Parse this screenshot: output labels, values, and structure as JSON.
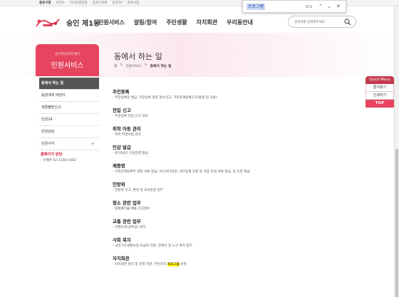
{
  "top_links": [
    "종로구청",
    "보건소",
    "역사문화관광",
    "종로구의회",
    "종로TV",
    "종로사랑"
  ],
  "find_bar": {
    "query": "프로그램",
    "count": "0/1"
  },
  "header": {
    "site_name": "숭인 제1동",
    "nav": [
      "민원서비스",
      "알림/참여",
      "주민생활",
      "자치회관",
      "우리동안내"
    ],
    "search_placeholder": "검색어를 입력해주세요"
  },
  "hero": {
    "title": "동에서 하는 일",
    "breadcrumb": [
      "홈",
      ">",
      "민원서비스",
      ">",
      "동에서 하는 일"
    ]
  },
  "sidebar": {
    "sub_title": "숭인제1동주민센터",
    "title": "민원서비스",
    "items": [
      "동에서 하는 일",
      "동장에게 바란다",
      "생활불편신고",
      "민원24",
      "민원상담",
      "민원서식"
    ],
    "contact_title": "홈페이지 담당",
    "contact_value": "- 유혜은 02-2148-5482"
  },
  "sections": [
    {
      "title": "주민등록",
      "desc": "- 주민등록증 발급, 주민등록 정정 접수신고, 가족관계등록신고(출생 및 사망)"
    },
    {
      "title": "전입 신고",
      "desc": "- 주민등록 전입 신고 처리"
    },
    {
      "title": "취학 아동 관리",
      "desc": "- 취학 학령아동 관리"
    },
    {
      "title": "인감 발급",
      "desc": "- 내·외국인 인감증명 발급"
    },
    {
      "title": "제증명",
      "desc": "- 가족관계등록부 관련 서류 발급, 어디서나민원, 세무증명 민원 등 각종 민원 서류 발급, 등.초본 발급"
    },
    {
      "title": "민방위",
      "desc": "- 민방위 신고, 편성 및 교육훈련 업무"
    },
    {
      "title": "청소 관련 업무",
      "desc": "- 대형폐기물 배출 신고접수"
    },
    {
      "title": "교통 관련 업무",
      "desc": "- 이면도로(골목길) 관리."
    },
    {
      "title": "사회 복지",
      "desc": "- 국민기초생활보장 수급자 지원, 장애인 및 노인 복지 업무"
    },
    {
      "title": "자치회관",
      "desc": "- 자치회관 관리 및 운영 지원, 주민자치 ",
      "highlight": "프로그램",
      "desc_after": " 운영"
    }
  ],
  "quick_menu": {
    "title": "Quick Menu",
    "items": [
      "즐겨찾기",
      "인쇄하기"
    ],
    "top": "TOP"
  },
  "colors": {
    "brand": "#e6445f",
    "quick_header": "#c43a4e",
    "find_highlight": "#ffe800",
    "sidebar_active": "#555555"
  }
}
